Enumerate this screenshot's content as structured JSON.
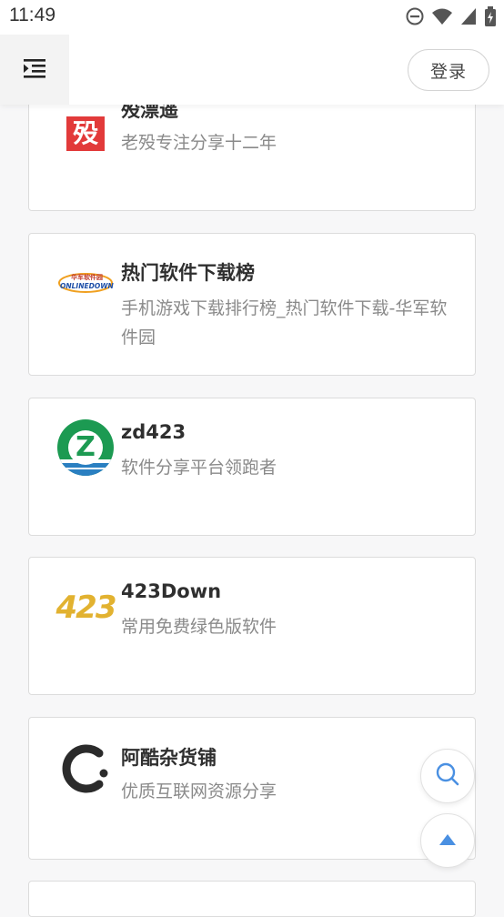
{
  "status_bar": {
    "time": "11:49"
  },
  "header": {
    "login_label": "登录"
  },
  "cards": [
    {
      "name": "殁漂遥",
      "desc": "老殁专注分享十二年",
      "logo_text": "殁"
    },
    {
      "name": "热门软件下载榜",
      "desc": "手机游戏下载排行榜_热门软件下载-华军软件园",
      "logo_text_top": "华军软件园",
      "logo_text_bottom": "ONLINEDOWN"
    },
    {
      "name": "zd423",
      "desc": "软件分享平台领跑者",
      "logo_text": "Z"
    },
    {
      "name": "423Down",
      "desc": "常用免费绿色版软件",
      "logo_text": "423"
    },
    {
      "name": "阿酷杂货铺",
      "desc": "优质互联网资源分享"
    }
  ],
  "colors": {
    "accent": "#4a90e2",
    "red": "#e23a3a",
    "green": "#1c9a52"
  }
}
